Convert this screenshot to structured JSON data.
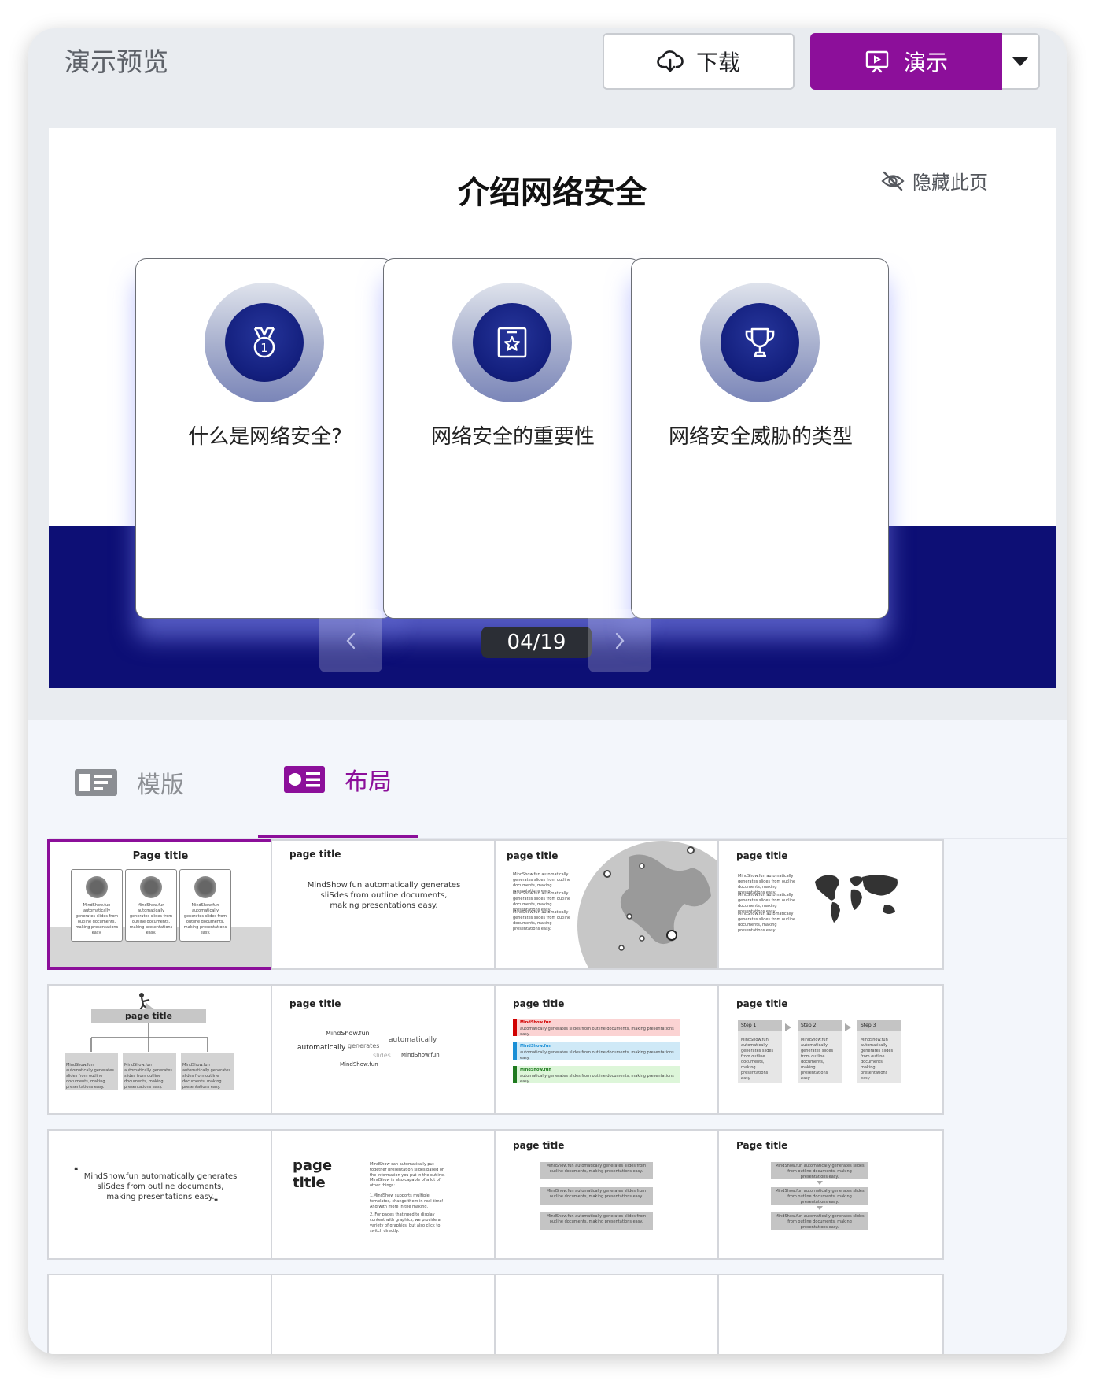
{
  "header": {
    "title": "演示预览",
    "download_label": "下载",
    "present_label": "演示"
  },
  "slide": {
    "title": "介绍网络安全",
    "hide_label": "隐藏此页",
    "page_counter": "04/19",
    "cards": [
      {
        "icon": "medal-icon",
        "text": "什么是网络安全?"
      },
      {
        "icon": "star-frame-icon",
        "text": "网络安全的重要性"
      },
      {
        "icon": "trophy-icon",
        "text": "网络安全威胁的类型"
      }
    ]
  },
  "tabs": {
    "template_label": "模版",
    "layout_label": "布局",
    "active": "layout"
  },
  "thumbnails": {
    "t1_title": "Page title",
    "t1_card_text": "MindShow.fun automatically generates slides from outline documents, making presentations easy.",
    "t2_title": "page title",
    "t2_text": "MindShow.fun automatically generates sliSdes from outline documents, making presentations easy.",
    "t3_title": "page title",
    "t3_item": "MindShow.fun automatically generates slides from outline documents, making presentations easy.",
    "t4_title": "page title",
    "t4_item": "MindShow.fun automatically generates slides from outline documents, making presentations easy.",
    "t5_title": "page title",
    "t5_box": "MindShow.fun automatically generates slides from outline documents, making presentations easy.",
    "t6_title": "page title",
    "t6_words": [
      "MindShow.fun",
      "automatically",
      "automatically",
      "generates",
      "slides",
      "MindShow.fun",
      "MindShow.fun"
    ],
    "t7_title": "page title",
    "t7_label": "MindShow.fun",
    "t7_text": "automatically generates slides from outline documents, making presentations easy.",
    "t8_title": "page title",
    "t8_steps": [
      "Step 1",
      "Step 2",
      "Step 3"
    ],
    "t8_text": "MindShow.fun automatically generates slides from outline documents, making presentations easy.",
    "t9_quote_open": "❝",
    "t9_text": "MindShow.fun automatically generates sliSdes from outline documents, making presentations easy.",
    "t9_quote_close": "❞",
    "t10_title": "page title",
    "t10_para1": "MindShow can automatically put together presentation slides based on the information you put in the outline.",
    "t10_para2": "MindShow is also capable of a lot of other things:",
    "t10_para3": "1.MindShow supports multiple templates, change them in real-time! And with more in the making.",
    "t10_para4": "2. For pages that need to display content with graphics, we provide a variety of graphics, but also click to switch directly.",
    "t11_title": "page title",
    "t11_box": "MindShow.fun automatically generates slides from outline documents, making presentations easy.",
    "t12_title": "Page title",
    "t12_box": "MindShow.fun automatically generates slides from outline documents, making presentations easy."
  },
  "colors": {
    "accent": "#8c0f9a",
    "slide_band": "#0d0f75",
    "icon_circle": "#14207f",
    "present_text": "#ffffff"
  }
}
